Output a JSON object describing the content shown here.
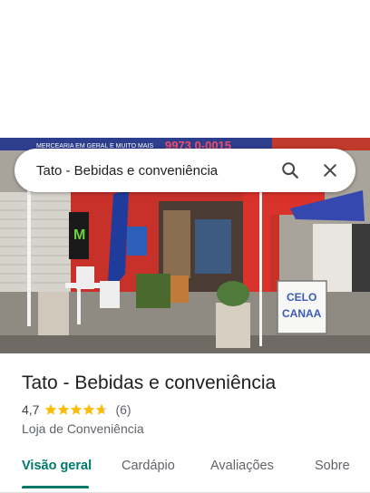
{
  "search": {
    "query": "Tato - Bebidas e conveniência"
  },
  "photo": {
    "banner_text": "9973 0-0015",
    "banner_small": "MERCEARIA EM GERAL E MUITO MAIS",
    "sign_text_1": "CELO",
    "sign_text_2": "CANAA"
  },
  "place": {
    "name": "Tato - Bebidas e conveniência",
    "rating": "4,7",
    "rating_value": 4.7,
    "review_count": "(6)",
    "category": "Loja de Conveniência"
  },
  "tabs": [
    {
      "label": "Visão geral"
    },
    {
      "label": "Cardápio"
    },
    {
      "label": "Avaliações"
    },
    {
      "label": "Sobre"
    }
  ],
  "colors": {
    "accent": "#00796b",
    "star": "#fbbc04"
  }
}
